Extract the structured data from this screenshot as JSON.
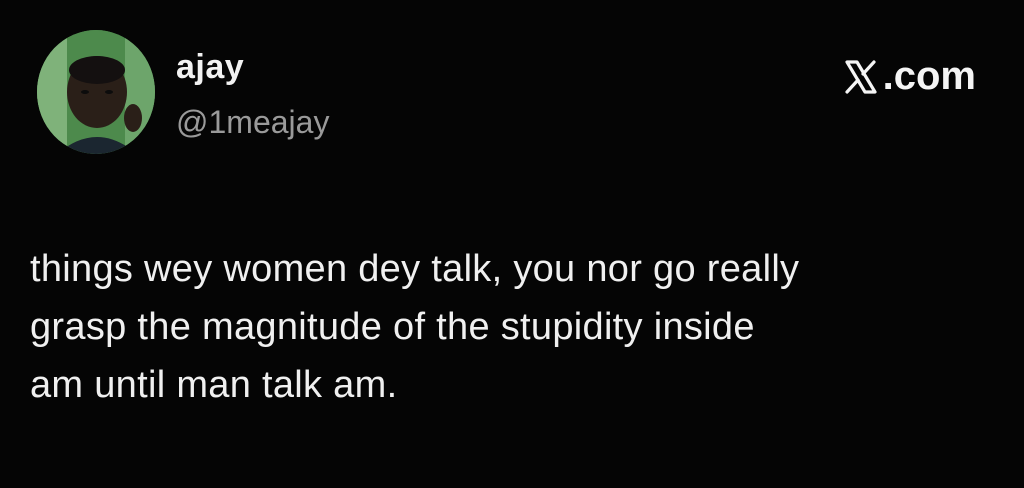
{
  "author": {
    "display_name": "ajay",
    "handle": "@1meajay"
  },
  "brand": {
    "label": ".com",
    "icon": "x-logo-icon"
  },
  "tweet": {
    "lines": [
      "things wey women dey talk, you nor go really",
      "grasp the magnitude of the stupidity inside",
      "am until man talk am."
    ]
  },
  "colors": {
    "background": "#050505",
    "text": "#f0f0f0",
    "handle": "#9a9a9a"
  }
}
